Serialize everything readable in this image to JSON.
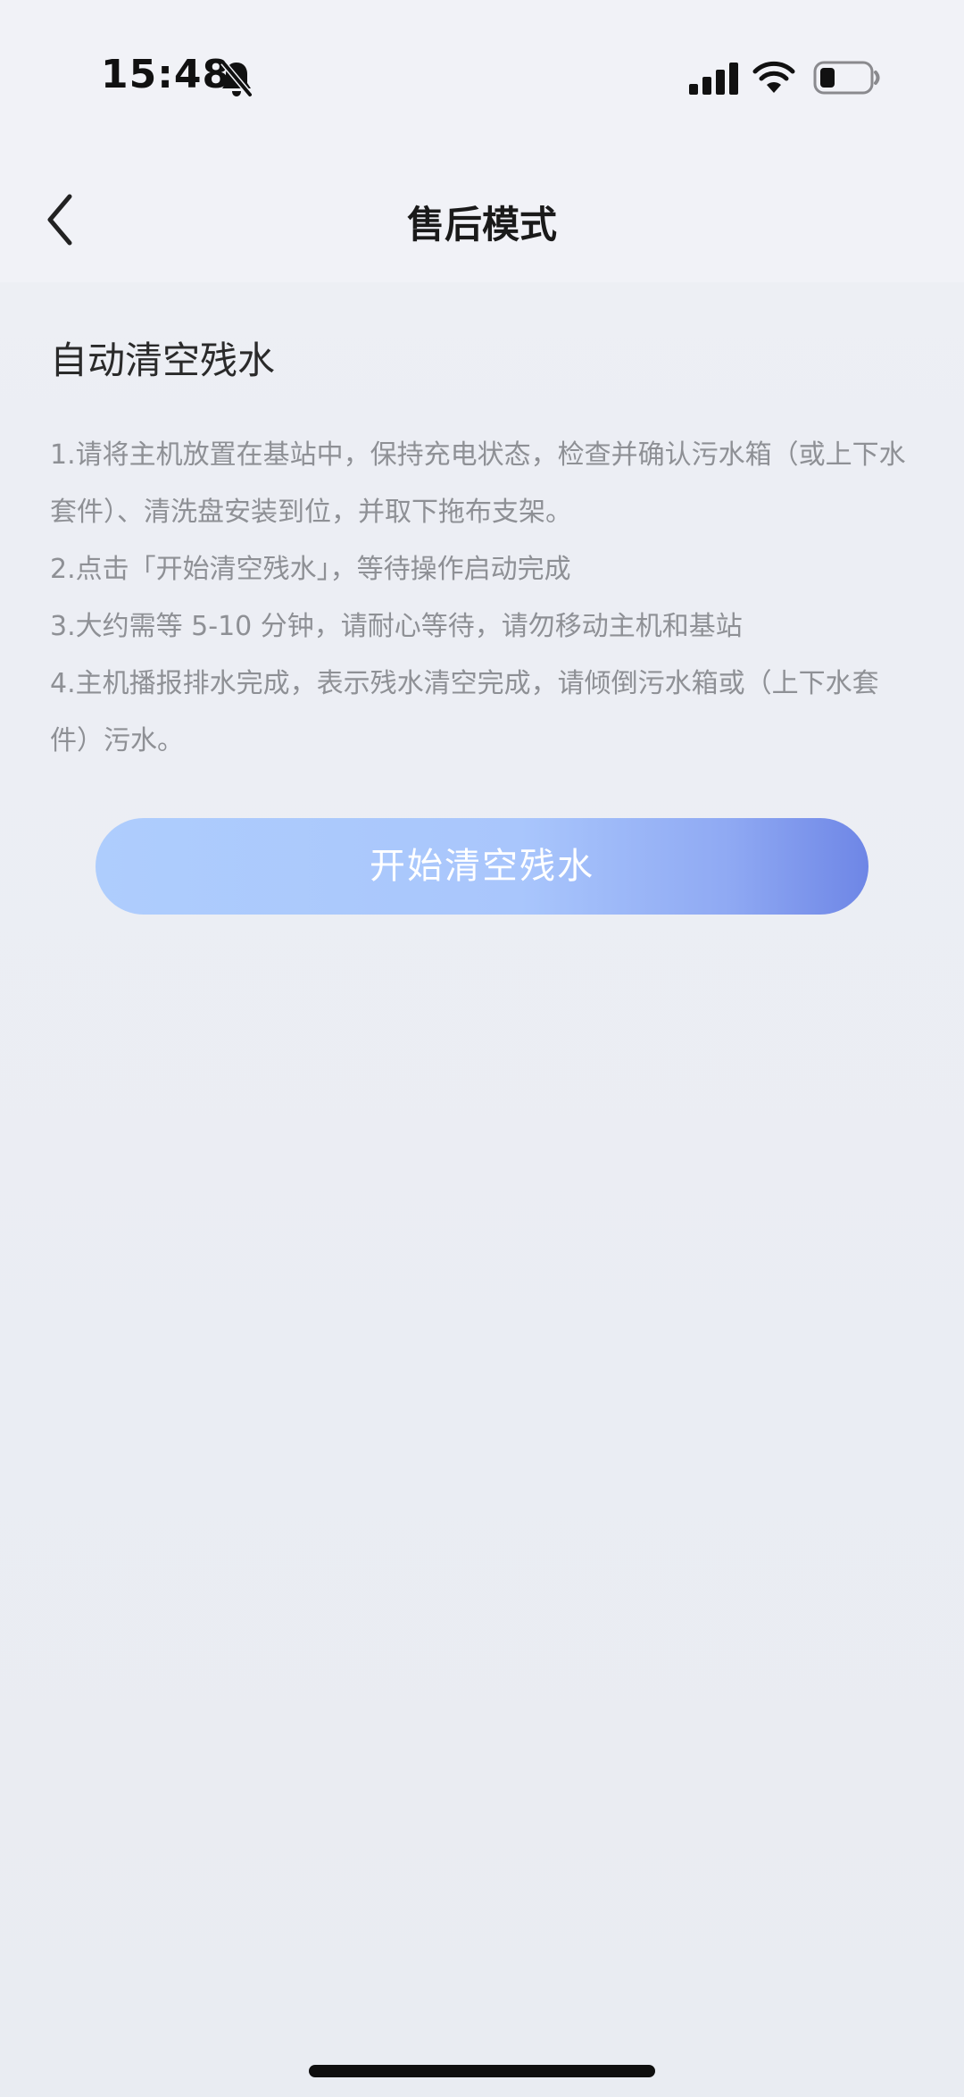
{
  "status_bar": {
    "time": "15:48",
    "icons": [
      "bell-slash-icon",
      "cellular-signal-icon",
      "wifi-icon",
      "battery-icon"
    ]
  },
  "nav": {
    "title": "售后模式",
    "back_icon": "chevron-left-icon"
  },
  "section": {
    "title": "自动清空残水",
    "steps": [
      "1.请将主机放置在基站中，保持充电状态，检查并确认污水箱（或上下水套件）、清洗盘安装到位，并取下拖布支架。",
      "2.点击「开始清空残水」，等待操作启动完成",
      "3.大约需等 5-10 分钟，请耐心等待，请勿移动主机和基站",
      "4.主机播报排水完成，表示残水清空完成，请倾倒污水箱或（上下水套件）污水。"
    ]
  },
  "action": {
    "start_label": "开始清空残水"
  },
  "colors": {
    "button_gradient_start": "#aecdfd",
    "button_gradient_end": "#6e86e6",
    "background": "#eceef4",
    "instruction_text": "#8e9095"
  }
}
